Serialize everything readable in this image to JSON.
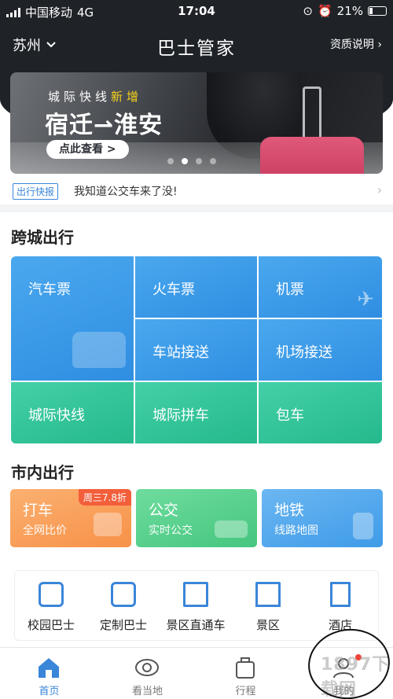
{
  "status_bar": {
    "carrier": "中国移动",
    "network": "4G",
    "time": "17:04",
    "battery": "21%"
  },
  "header": {
    "city": "苏州",
    "title": "巴士管家",
    "qualification": "资质说明"
  },
  "banner": {
    "subtitle_prefix": "城际快线",
    "subtitle_highlight": "新增",
    "route": "宿迁⇀淮安",
    "button": "点此查看 >",
    "dots": 4,
    "active_dot": 2
  },
  "news": {
    "tag": "出行快报",
    "text": "我知道公交车来了没!"
  },
  "cross_city": {
    "title": "跨城出行",
    "tiles": [
      "汽车票",
      "火车票",
      "机票",
      "车站接送",
      "机场接送",
      "城际快线",
      "城际拼车",
      "包车"
    ]
  },
  "in_city": {
    "title": "市内出行",
    "cards": [
      {
        "title": "打车",
        "subtitle": "全网比价",
        "badge": "周三7.8折",
        "color": "#f9a35b"
      },
      {
        "title": "公交",
        "subtitle": "实时公交",
        "color": "#55d18e"
      },
      {
        "title": "地铁",
        "subtitle": "线路地图",
        "color": "#51a8ee"
      }
    ]
  },
  "quick_services": [
    "校园巴士",
    "定制巴士",
    "景区直通车",
    "景区",
    "酒店"
  ],
  "tabbar": {
    "items": [
      "首页",
      "看当地",
      "行程",
      "我的"
    ],
    "active": 0
  },
  "watermark": "1897下载网",
  "colors": {
    "primary": "#3a86d9",
    "dark_header": "#1f2328",
    "accent_yellow": "#f7d21b"
  }
}
